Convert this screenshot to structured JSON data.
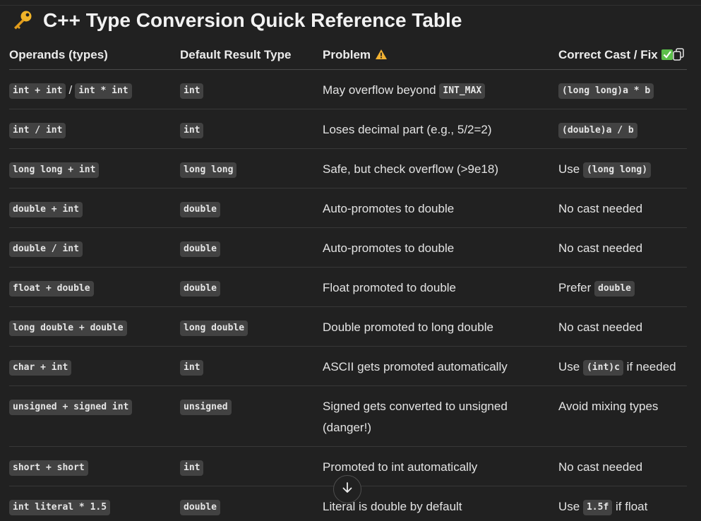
{
  "title": "C++ Type Conversion Quick Reference Table",
  "title_icon": "key-icon",
  "headers": {
    "operands": "Operands (types)",
    "result": "Default Result Type",
    "problem": "Problem",
    "fix": "Correct Cast / Fix"
  },
  "header_icons": {
    "problem": "warning-icon",
    "fix": "check-mark-icon"
  },
  "copy_icon": "copy-icon",
  "rows": [
    {
      "operands_a": "int + int",
      "operands_sep": "/",
      "operands_b": "int * int",
      "result": "int",
      "problem_text": "May overflow beyond ",
      "problem_code": "INT_MAX",
      "fix_pre": "",
      "fix_code": "(long long)a * b",
      "fix_post": ""
    },
    {
      "operands_a": "int / int",
      "result": "int",
      "problem_text": "Loses decimal part (e.g., 5/2=2)",
      "fix_pre": "",
      "fix_code": "(double)a / b",
      "fix_post": ""
    },
    {
      "operands_a": "long long + int",
      "result": "long long",
      "problem_text": "Safe, but check overflow (>9e18)",
      "fix_pre": "Use ",
      "fix_code": "(long long)",
      "fix_post": ""
    },
    {
      "operands_a": "double + int",
      "result": "double",
      "problem_text": "Auto-promotes to double",
      "fix_pre": "No cast needed"
    },
    {
      "operands_a": "double / int",
      "result": "double",
      "problem_text": "Auto-promotes to double",
      "fix_pre": "No cast needed"
    },
    {
      "operands_a": "float + double",
      "result": "double",
      "problem_text": "Float promoted to double",
      "fix_pre": "Prefer ",
      "fix_code": "double",
      "fix_post": ""
    },
    {
      "operands_a": "long double + double",
      "result": "long double",
      "problem_text": "Double promoted to long double",
      "fix_pre": "No cast needed"
    },
    {
      "operands_a": "char + int",
      "result": "int",
      "problem_text": "ASCII gets promoted automatically",
      "fix_pre": "Use ",
      "fix_code": "(int)c",
      "fix_post": " if needed"
    },
    {
      "operands_a": "unsigned + signed int",
      "result": "unsigned",
      "problem_text": "Signed gets converted to unsigned (danger!)",
      "fix_pre": "Avoid mixing types"
    },
    {
      "operands_a": "short + short",
      "result": "int",
      "problem_text": "Promoted to int automatically",
      "fix_pre": "No cast needed"
    },
    {
      "operands_a": "int literal * 1.5",
      "result": "double",
      "problem_text": "Literal is double by default",
      "fix_pre": "Use ",
      "fix_code": "1.5f",
      "fix_post": " if float"
    }
  ],
  "scroll_button_icon": "arrow-down-icon",
  "colors": {
    "background": "#212121",
    "code_background": "#424242",
    "text": "#ececec",
    "warning": "#f2b233",
    "check": "#5cbf4a"
  }
}
